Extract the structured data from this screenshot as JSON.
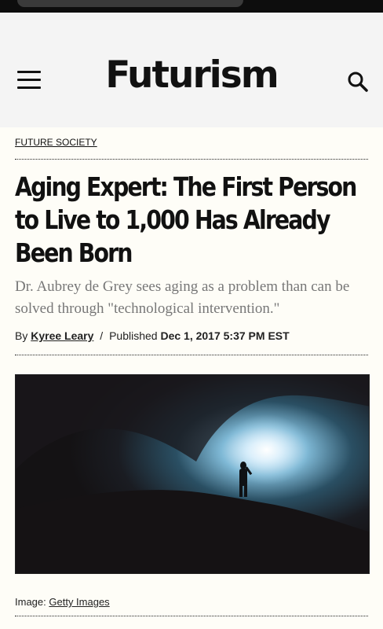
{
  "header": {
    "logo": "Futurism",
    "menu_icon": "hamburger-menu-icon",
    "search_icon": "search-icon"
  },
  "article": {
    "category": "FUTURE SOCIETY",
    "headline": "Aging Expert: The First Person to Live to 1,000 Has Already Been Born",
    "dek": "Dr. Aubrey de Grey sees aging as a problem than can be solved through \"technological intervention.\"",
    "byline": {
      "by_label": "By",
      "author": "Kyree Leary",
      "separator": "/",
      "published_label": "Published",
      "date": "Dec 1, 2017 5:37 PM EST"
    },
    "image_caption": {
      "label": "Image:",
      "credit": "Getty Images"
    }
  },
  "colors": {
    "page_background": "#fefdf7",
    "header_background": "#f4f4f4",
    "text": "#111111",
    "dek_text": "#777777"
  }
}
